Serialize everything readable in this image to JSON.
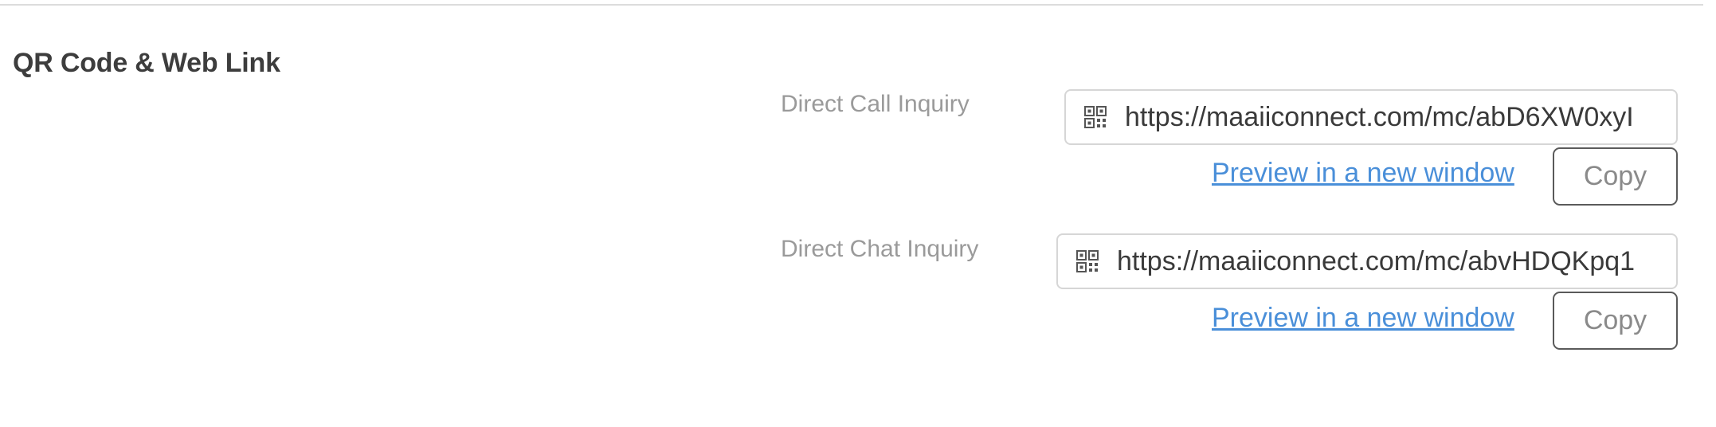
{
  "section": {
    "title": "QR Code & Web Link"
  },
  "rows": [
    {
      "label": "Direct Call Inquiry",
      "url": "https://maaiiconnect.com/mc/abD6XW0xyI",
      "preview_label": "Preview in a new window",
      "copy_label": "Copy",
      "icon": "qr-code-icon"
    },
    {
      "label": "Direct Chat Inquiry",
      "url": "https://maaiiconnect.com/mc/abvHDQKpq1",
      "preview_label": "Preview in a new window",
      "copy_label": "Copy",
      "icon": "qr-code-icon"
    }
  ],
  "colors": {
    "link": "#4a8fd9",
    "label": "#9a9a9a",
    "title": "#3d3d3d",
    "field_border": "#d6d6d6",
    "button_border": "#5a5a5a"
  }
}
